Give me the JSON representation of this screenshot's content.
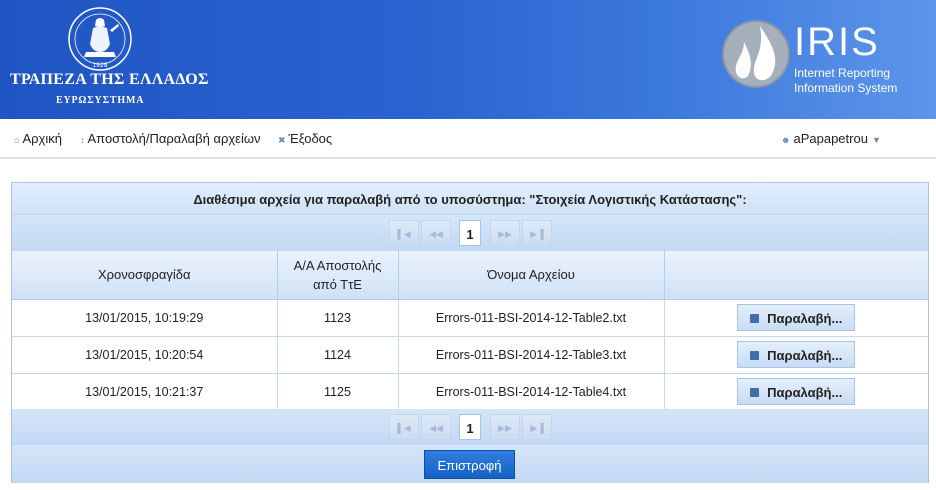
{
  "header": {
    "bank_name": "ΤΡΑΠΕΖΑ ΤΗΣ ΕΛΛΑΔΟΣ",
    "bank_sub": "ΕΥΡΩΣΥΣΤΗΜΑ",
    "logo_year": "1928",
    "iris_title": "IRIS",
    "iris_line1": "Internet Reporting",
    "iris_line2": "Information System"
  },
  "nav": {
    "home": "Αρχική",
    "transfer": "Αποστολή/Παραλαβή αρχείων",
    "logout": "Έξοδος",
    "user": "aPapapetrou"
  },
  "panel": {
    "caption": "Διαθέσιμα αρχεία για παραλαβή από το υποσύστημα: \"Στοιχεία Λογιστικής Κατάστασης\":",
    "current_page": "1",
    "columns": {
      "timestamp": "Χρονοσφραγίδα",
      "seq_line1": "Α/Α Αποστολής",
      "seq_line2": "από ΤτΕ",
      "filename": "Όνομα Αρχείου"
    },
    "rows": [
      {
        "timestamp": "13/01/2015, 10:19:29",
        "seq": "1123",
        "filename": "Errors-011-BSI-2014-12-Table2.txt",
        "action": "Παραλαβή..."
      },
      {
        "timestamp": "13/01/2015, 10:20:54",
        "seq": "1124",
        "filename": "Errors-011-BSI-2014-12-Table3.txt",
        "action": "Παραλαβή..."
      },
      {
        "timestamp": "13/01/2015, 10:21:37",
        "seq": "1125",
        "filename": "Errors-011-BSI-2014-12-Table4.txt",
        "action": "Παραλαβή..."
      }
    ],
    "back_label": "Επιστροφή"
  },
  "colors": {
    "header_blue": "#1f55c3",
    "accent": "#1560c4",
    "panel_border": "#a7c4e2"
  }
}
